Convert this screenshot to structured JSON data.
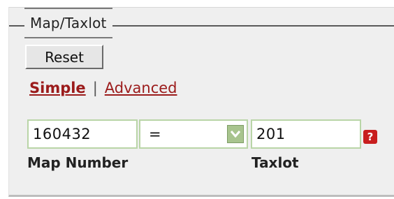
{
  "section": {
    "title": "Map/Taxlot"
  },
  "buttons": {
    "reset": "Reset"
  },
  "modes": {
    "simple": "Simple",
    "separator": "|",
    "advanced": "Advanced"
  },
  "fields": {
    "map_number": {
      "value": "160432",
      "label": "Map Number"
    },
    "operator": {
      "selected": "="
    },
    "taxlot": {
      "value": "201",
      "label": "Taxlot"
    }
  },
  "icons": {
    "help": "help-icon",
    "dropdown": "chevron-down-icon"
  },
  "colors": {
    "link": "#9b1b1b",
    "input_border": "#b9d5a7",
    "dropdown_button": "#a8c48e",
    "help_icon": "#c81e1e",
    "panel_background": "#efefef"
  }
}
